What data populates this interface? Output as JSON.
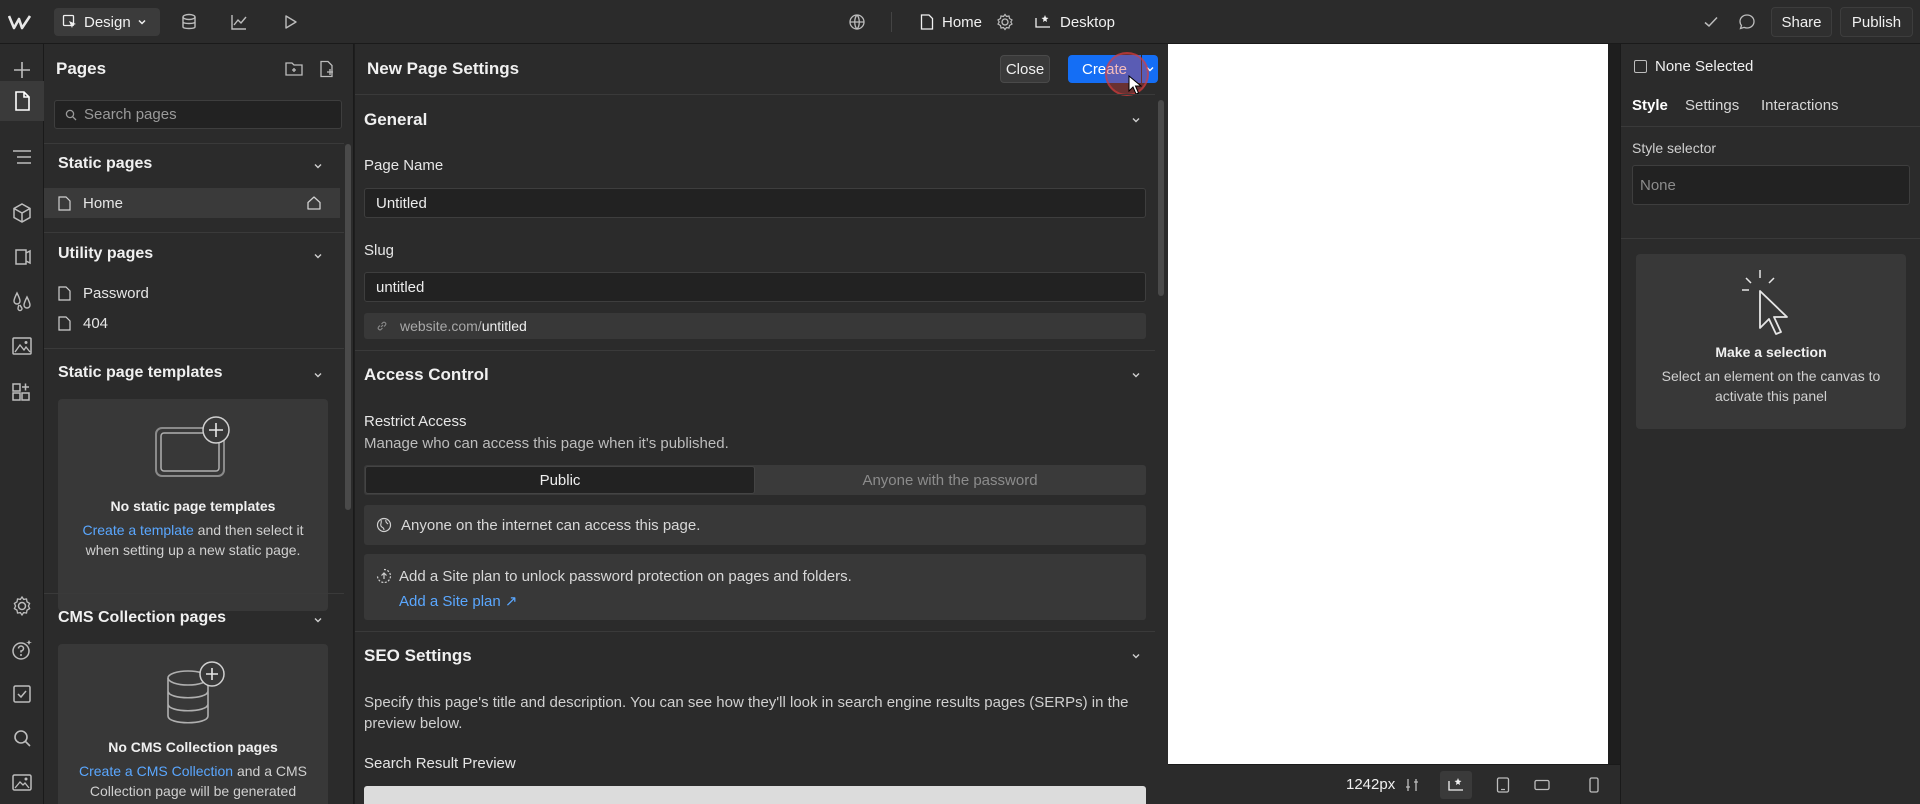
{
  "topbar": {
    "logo": "W",
    "mode_label": "Design",
    "page_name": "Home",
    "breakpoint_label": "Desktop",
    "share_label": "Share",
    "publish_label": "Publish"
  },
  "pages_panel": {
    "title": "Pages",
    "search_placeholder": "Search pages",
    "static_pages": {
      "title": "Static pages",
      "items": [
        {
          "label": "Home"
        }
      ]
    },
    "utility_pages": {
      "title": "Utility pages",
      "items": [
        {
          "label": "Password"
        },
        {
          "label": "404"
        }
      ]
    },
    "templates": {
      "title": "Static page templates",
      "empty_title": "No static page templates",
      "link": "Create a template",
      "text_after_link": " and then select it when setting up a new static page."
    },
    "cms": {
      "title": "CMS Collection pages",
      "empty_title": "No CMS Collection pages",
      "link": "Create a CMS Collection",
      "text_after_link": " and a CMS Collection page will be generated"
    }
  },
  "settings": {
    "title": "New Page Settings",
    "close_label": "Close",
    "create_label": "Create",
    "general": {
      "title": "General",
      "page_name_label": "Page Name",
      "page_name_value": "Untitled",
      "slug_label": "Slug",
      "slug_value": "untitled",
      "url_prefix": "website.com/",
      "url_slug": "untitled"
    },
    "access": {
      "title": "Access Control",
      "restrict_label": "Restrict Access",
      "restrict_desc": "Manage who can access this page when it's published.",
      "option_public": "Public",
      "option_password": "Anyone with the password",
      "info_text": "Anyone on the internet can access this page.",
      "plan_text": "Add a Site plan to unlock password protection on pages and folders.",
      "plan_link": "Add a Site plan ↗"
    },
    "seo": {
      "title": "SEO Settings",
      "desc": "Specify this page's title and description. You can see how they'll look in search engine results pages (SERPs) in the preview below.",
      "preview_label": "Search Result Preview"
    }
  },
  "canvas": {
    "width_label": "1242px"
  },
  "right_panel": {
    "none_selected": "None Selected",
    "tabs": [
      "Style",
      "Settings",
      "Interactions"
    ],
    "style_selector_label": "Style selector",
    "style_selector_value": "None",
    "empty_title": "Make a selection",
    "empty_desc": "Select an element on the canvas to activate this panel"
  },
  "colors": {
    "accent": "#146ef5",
    "link": "#5aa7ff",
    "panel": "#2b2b2b",
    "canvas": "#ffffff"
  }
}
